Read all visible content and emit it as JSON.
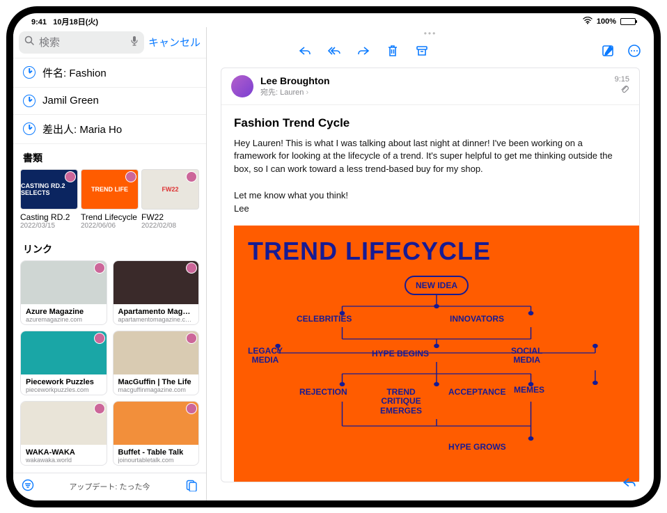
{
  "status": {
    "time": "9:41",
    "date": "10月18日(火)",
    "battery": "100%"
  },
  "search": {
    "placeholder": "検索",
    "cancel": "キャンセル"
  },
  "filters": [
    {
      "label": "件名: Fashion"
    },
    {
      "label": "Jamil Green"
    },
    {
      "label": "差出人: Maria Ho"
    }
  ],
  "sections": {
    "documents": "書類",
    "links": "リンク"
  },
  "documents": [
    {
      "title": "Casting RD.2",
      "date": "2022/03/15",
      "bg": "#0b2560",
      "text": "CASTING RD.2 SELECTS"
    },
    {
      "title": "Trend Lifecycle",
      "date": "2022/06/06",
      "bg": "#ff5c00",
      "text": "TREND LIFE"
    },
    {
      "title": "FW22",
      "date": "2022/02/08",
      "bg": "#e9e6de",
      "text": "FW22"
    }
  ],
  "links": [
    {
      "title": "Azure Magazine",
      "url": "azuremagazine.com",
      "bg": "#cfd6d3"
    },
    {
      "title": "Apartamento Maga…",
      "url": "apartamentomagazine.c…",
      "bg": "#3a2a2a"
    },
    {
      "title": "Piecework Puzzles",
      "url": "pieceworkpuzzles.com",
      "bg": "#1aa6a6"
    },
    {
      "title": "MacGuffin | The Life",
      "url": "macguffinmagazine.com",
      "bg": "#d9cbb2"
    },
    {
      "title": "WAKA-WAKA",
      "url": "wakawaka.world",
      "bg": "#e9e4d8"
    },
    {
      "title": "Buffet - Table Talk",
      "url": "joinourtabletalk.com",
      "bg": "#f28f3b"
    }
  ],
  "footer": {
    "status": "アップデート: たった今"
  },
  "mail": {
    "sender": "Lee Broughton",
    "to_label": "宛先:",
    "to_name": "Lauren",
    "time": "9:15",
    "subject": "Fashion Trend Cycle",
    "body_p1": "Hey Lauren! This is what I was talking about last night at dinner! I've been working on a framework for looking at the lifecycle of a trend. It's super helpful to get me thinking outside the box, so I can work toward a less trend-based buy for my shop.",
    "body_p2": "Let me know what you think!",
    "body_sig": "Lee"
  },
  "diagram": {
    "title": "TREND LIFECYCLE",
    "new_idea": "NEW IDEA",
    "nodes": {
      "celebrities": "CELEBRITIES",
      "innovators": "INNOVATORS",
      "legacy_media": "LEGACY\nMEDIA",
      "hype_begins": "HYPE BEGINS",
      "social_media": "SOCIAL\nMEDIA",
      "memes": "MEMES",
      "rejection": "REJECTION",
      "trend_critique": "TREND\nCRITIQUE\nEMERGES",
      "acceptance": "ACCEPTANCE",
      "hype_grows": "HYPE GROWS"
    }
  }
}
